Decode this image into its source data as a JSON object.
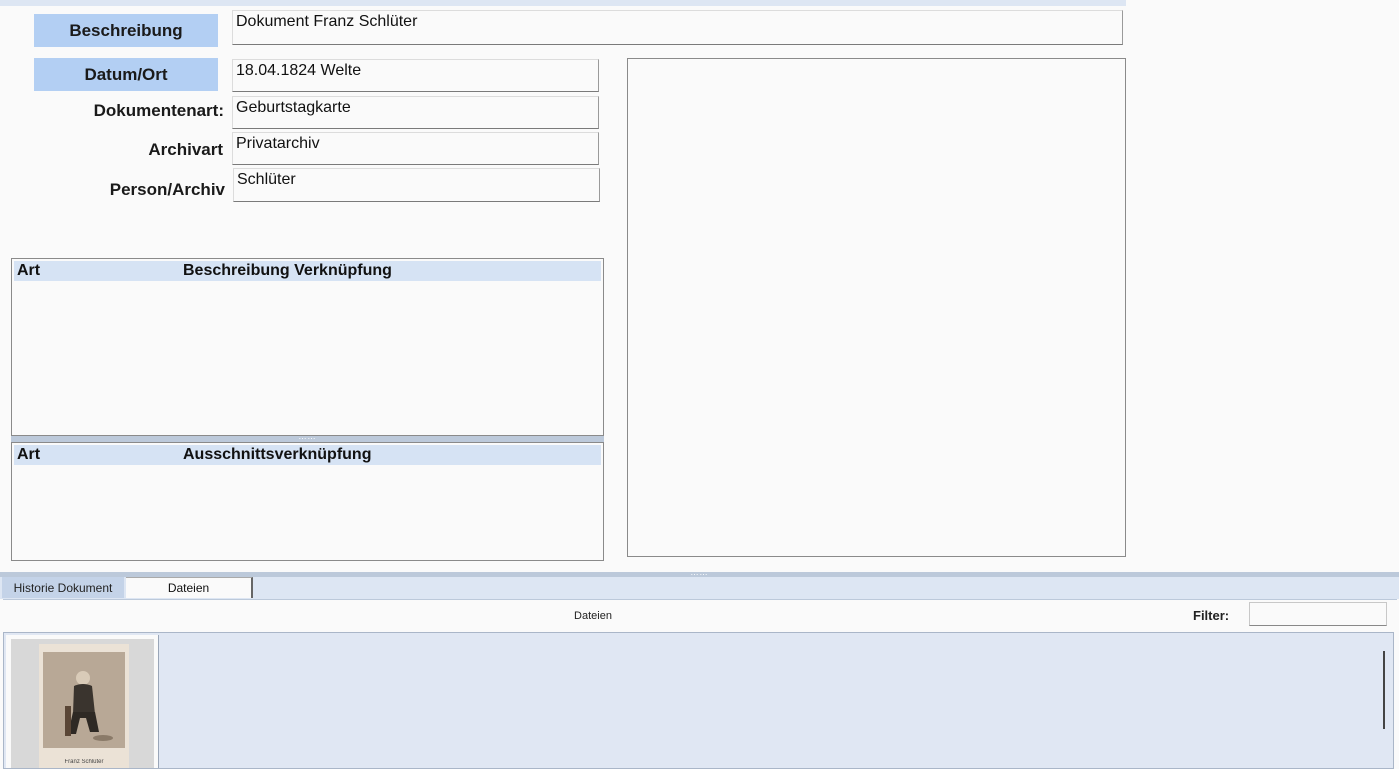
{
  "form": {
    "beschreibung_label": "Beschreibung",
    "beschreibung_value": "Dokument Franz Schlüter",
    "datum_label": "Datum/Ort",
    "datum_value": "18.04.1824 Welte",
    "dokumentenart_label": "Dokumentenart:",
    "dokumentenart_value": "Geburtstagkarte",
    "archivart_label": "Archivart",
    "archivart_value": "Privatarchiv",
    "person_label": "Person/Archiv",
    "person_value": "Schlüter"
  },
  "grid1": {
    "col_art": "Art",
    "col_desc": "Beschreibung Verknüpfung"
  },
  "grid2": {
    "col_art": "Art",
    "col_desc": "Ausschnittsverknüpfung"
  },
  "tabs": [
    {
      "label": "Historie Dokument",
      "active": false
    },
    {
      "label": "Dateien",
      "active": true
    }
  ],
  "files": {
    "title": "Dateien",
    "filter_label": "Filter:",
    "filter_value": "",
    "thumbnail_caption": "Franz Schlüter"
  },
  "colors": {
    "label_blue": "#b3cff3",
    "header_blue": "#d6e3f4",
    "panel_bg": "#e0e7f3"
  }
}
